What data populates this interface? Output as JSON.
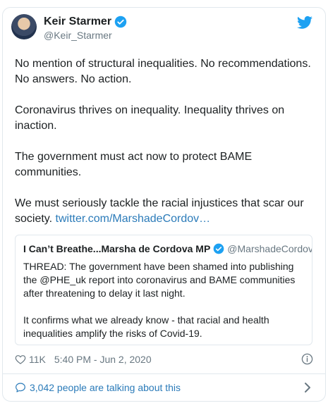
{
  "author": {
    "name": "Keir Starmer",
    "handle": "@Keir_Starmer"
  },
  "tweet": {
    "paragraphs": [
      "No mention of structural inequalities. No recommendations. No answers. No action.",
      "Coronavirus thrives on inequality. Inequality thrives on inaction.",
      "The government must act now to protect BAME communities.",
      "We must seriously tackle the racial injustices that scar our society."
    ],
    "link_text": "twitter.com/MarshadeCordov…"
  },
  "quoted": {
    "name": "I Can’t Breathe...Marsha de Cordova MP",
    "handle": "@MarshadeCordova",
    "paragraphs": [
      "THREAD: The government have been shamed into publishing the @PHE_uk report into coronavirus and BAME communities after threatening to delay it last night.",
      "It confirms what we already know - that racial and health inequalities amplify the risks of Covid-19."
    ]
  },
  "meta": {
    "likes": "11K",
    "timestamp": "5:40 PM - Jun 2, 2020"
  },
  "conversation": {
    "label": "3,042 people are talking about this"
  },
  "colors": {
    "twitter_blue": "#1da1f2",
    "link": "#2b7bb9",
    "secondary_text": "#697882",
    "border": "#e1e8ed"
  },
  "icons": [
    "twitter-logo-icon",
    "verified-badge-icon",
    "heart-icon",
    "info-icon",
    "comment-bubble-icon",
    "chevron-right-icon"
  ]
}
